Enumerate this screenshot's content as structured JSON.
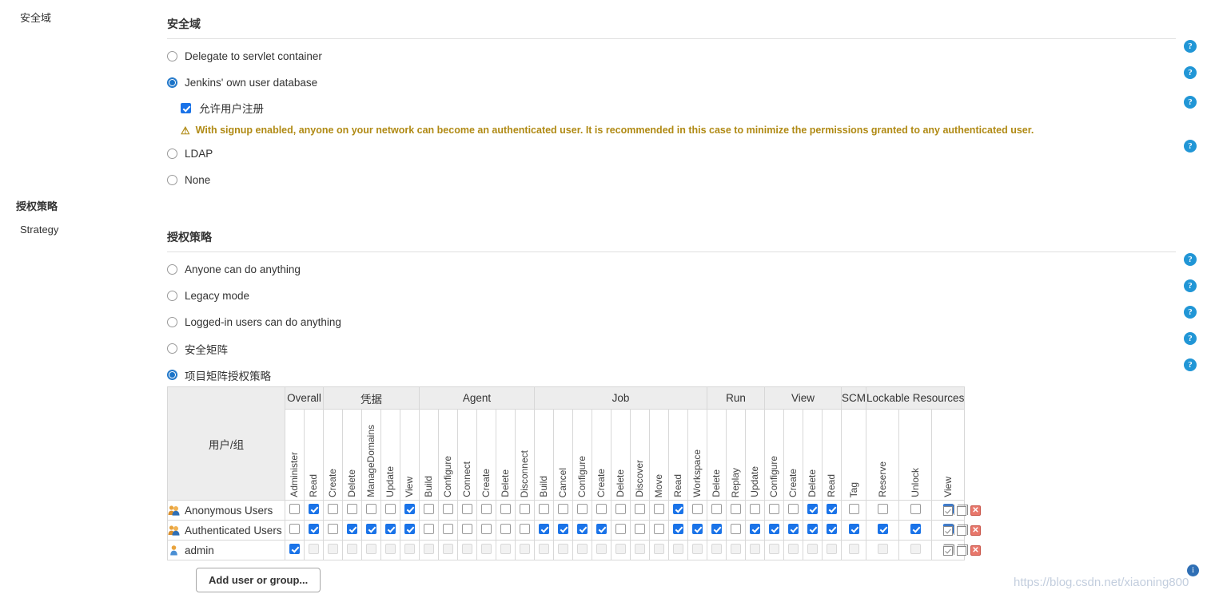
{
  "security_realm": {
    "gutter_label": "安全域",
    "title": "安全域",
    "options": [
      {
        "label": "Delegate to servlet container",
        "selected": false
      },
      {
        "label": "Jenkins' own user database",
        "selected": true
      },
      {
        "label": "LDAP",
        "selected": false
      },
      {
        "label": "None",
        "selected": false
      }
    ],
    "allow_signup": {
      "label": "允许用户注册",
      "checked": true
    },
    "warning": {
      "icon": "warning-triangle-icon",
      "text": "With signup enabled, anyone on your network can become an authenticated user. It is recommended in this case to minimize the permissions granted to any authenticated user."
    }
  },
  "authorization": {
    "gutter_label": "授权策略",
    "strategy_label": "Strategy",
    "title": "授权策略",
    "options": [
      {
        "label": "Anyone can do anything",
        "selected": false
      },
      {
        "label": "Legacy mode",
        "selected": false
      },
      {
        "label": "Logged-in users can do anything",
        "selected": false
      },
      {
        "label": "安全矩阵",
        "selected": false
      },
      {
        "label": "项目矩阵授权策略",
        "selected": true
      }
    ]
  },
  "help_icon_glyph": "?",
  "matrix": {
    "user_column_header": "用户/组",
    "groups": [
      {
        "label": "Overall",
        "span": 2
      },
      {
        "label": "凭据",
        "span": 5
      },
      {
        "label": "Agent",
        "span": 6
      },
      {
        "label": "Job",
        "span": 9
      },
      {
        "label": "Run",
        "span": 3
      },
      {
        "label": "View",
        "span": 4
      },
      {
        "label": "SCM",
        "span": 1
      },
      {
        "label": "Lockable Resources",
        "span": 3
      }
    ],
    "permissions": [
      "Administer",
      "Read",
      "Create",
      "Delete",
      "ManageDomains",
      "Update",
      "View",
      "Build",
      "Configure",
      "Connect",
      "Create",
      "Delete",
      "Disconnect",
      "Build",
      "Cancel",
      "Configure",
      "Create",
      "Delete",
      "Discover",
      "Move",
      "Read",
      "Workspace",
      "Delete",
      "Replay",
      "Update",
      "Configure",
      "Create",
      "Delete",
      "Read",
      "Tag",
      "Reserve",
      "Unlock",
      "View"
    ],
    "rows": [
      {
        "name": "Anonymous Users",
        "icon": "group-icon",
        "disabled": false,
        "checks": [
          false,
          true,
          false,
          false,
          false,
          false,
          true,
          false,
          false,
          false,
          false,
          false,
          false,
          false,
          false,
          false,
          false,
          false,
          false,
          false,
          true,
          false,
          false,
          false,
          false,
          false,
          false,
          true,
          true,
          false,
          false,
          false,
          true
        ]
      },
      {
        "name": "Authenticated Users",
        "icon": "group-icon",
        "disabled": false,
        "checks": [
          false,
          true,
          false,
          true,
          true,
          true,
          true,
          false,
          false,
          false,
          false,
          false,
          false,
          true,
          true,
          true,
          true,
          false,
          false,
          false,
          true,
          true,
          true,
          false,
          true,
          true,
          true,
          true,
          true,
          true,
          true,
          true,
          true
        ]
      },
      {
        "name": "admin",
        "icon": "user-icon",
        "disabled": true,
        "checks": [
          true,
          false,
          false,
          false,
          false,
          false,
          false,
          false,
          false,
          false,
          false,
          false,
          false,
          false,
          false,
          false,
          false,
          false,
          false,
          false,
          false,
          false,
          false,
          false,
          false,
          false,
          false,
          false,
          false,
          false,
          false,
          false,
          false
        ]
      }
    ],
    "row_actions": [
      {
        "name": "select-all-icon"
      },
      {
        "name": "copy-icon"
      },
      {
        "name": "delete-icon",
        "glyph": "✕"
      }
    ]
  },
  "add_button_label": "Add user or group...",
  "watermark": "https://blog.csdn.net/xiaoning800"
}
